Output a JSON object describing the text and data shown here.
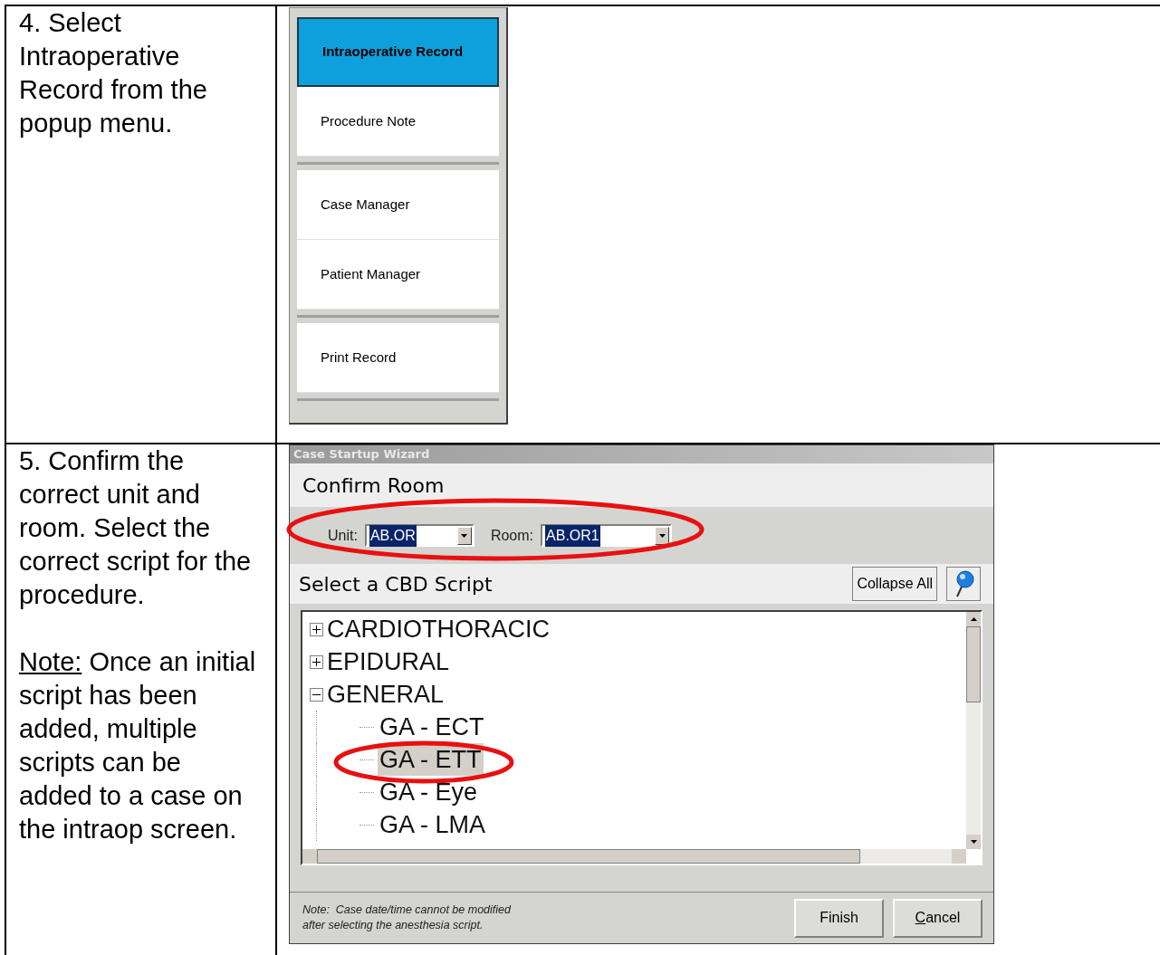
{
  "steps": [
    {
      "number": "4.",
      "text": "Select Intraoperative Record from the popup menu."
    },
    {
      "number": "5.",
      "text": "Confirm the correct unit and room. Select the correct script for the procedure.",
      "note_label": "Note:",
      "note_text": "Once an initial script has been added, multiple scripts can be added to a case on the intraop screen."
    }
  ],
  "popup_menu": {
    "items": [
      {
        "label": "Intraoperative Record",
        "selected": true,
        "separator_after": false
      },
      {
        "label": "Procedure Note",
        "selected": false,
        "separator_after": true
      },
      {
        "label": "Case Manager",
        "selected": false,
        "separator_after": false
      },
      {
        "label": "Patient Manager",
        "selected": false,
        "separator_after": true
      },
      {
        "label": "Print Record",
        "selected": false,
        "separator_after": true
      }
    ]
  },
  "wizard": {
    "title": "Case Startup Wizard",
    "section_title": "Confirm Room",
    "unit": {
      "label": "Unit:",
      "value": "AB.OR"
    },
    "room": {
      "label": "Room:",
      "value": "AB.OR1"
    },
    "script_title": "Select a CBD Script",
    "collapse_button": "Collapse All",
    "tree": [
      {
        "label": "CARDIOTHORACIC",
        "expanded": false
      },
      {
        "label": "EPIDURAL",
        "expanded": false
      },
      {
        "label": "GENERAL",
        "expanded": true,
        "children": [
          {
            "label": "GA - ECT",
            "selected": false
          },
          {
            "label": "GA - ETT",
            "selected": true
          },
          {
            "label": "GA - Eye",
            "selected": false
          },
          {
            "label": "GA - LMA",
            "selected": false
          }
        ]
      }
    ],
    "footer_note": [
      "Note:  Case date/time cannot be modified",
      "after selecting the anesthesia script."
    ],
    "buttons": [
      "Finish",
      "Cancel"
    ]
  }
}
